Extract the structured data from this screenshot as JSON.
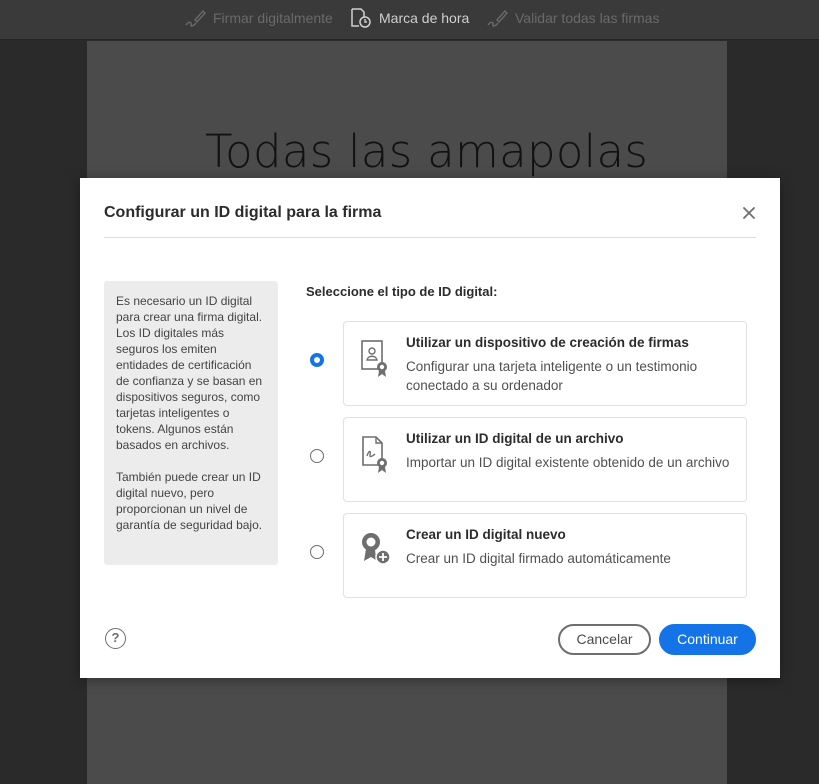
{
  "toolbar": {
    "sign_digitally": "Firmar digitalmente",
    "timestamp": "Marca de hora",
    "validate_all": "Validar todas las firmas"
  },
  "document": {
    "title": "Todas las amapolas"
  },
  "dialog": {
    "title": "Configurar un ID digital para la firma",
    "info_paragraph_1": "Es necesario un ID digital para crear una firma digital. Los ID digitales más seguros los emiten entidades de certificación de confianza y se basan en dispositivos seguros, como tarjetas inteligentes o tokens. Algunos están basados en archivos.",
    "info_paragraph_2": "También puede crear un ID digital nuevo, pero proporcionan un nivel de garantía de seguridad bajo.",
    "select_label": "Seleccione el tipo de ID digital:",
    "options": [
      {
        "title": "Utilizar un dispositivo de creación de firmas",
        "description": "Configurar una tarjeta inteligente o un testimonio conectado a su ordenador",
        "selected": true,
        "icon": "smart-card-icon"
      },
      {
        "title": "Utilizar un ID digital de un archivo",
        "description": "Importar un ID digital existente obtenido de un archivo",
        "selected": false,
        "icon": "signed-file-icon"
      },
      {
        "title": "Crear un ID digital nuevo",
        "description": "Crear un ID digital firmado automáticamente",
        "selected": false,
        "icon": "new-badge-icon"
      }
    ],
    "help_symbol": "?",
    "cancel_label": "Cancelar",
    "continue_label": "Continuar"
  },
  "colors": {
    "accent": "#1473e6",
    "toolbar_bg": "#3a3a3a",
    "backdrop": "#2a2a2a"
  }
}
